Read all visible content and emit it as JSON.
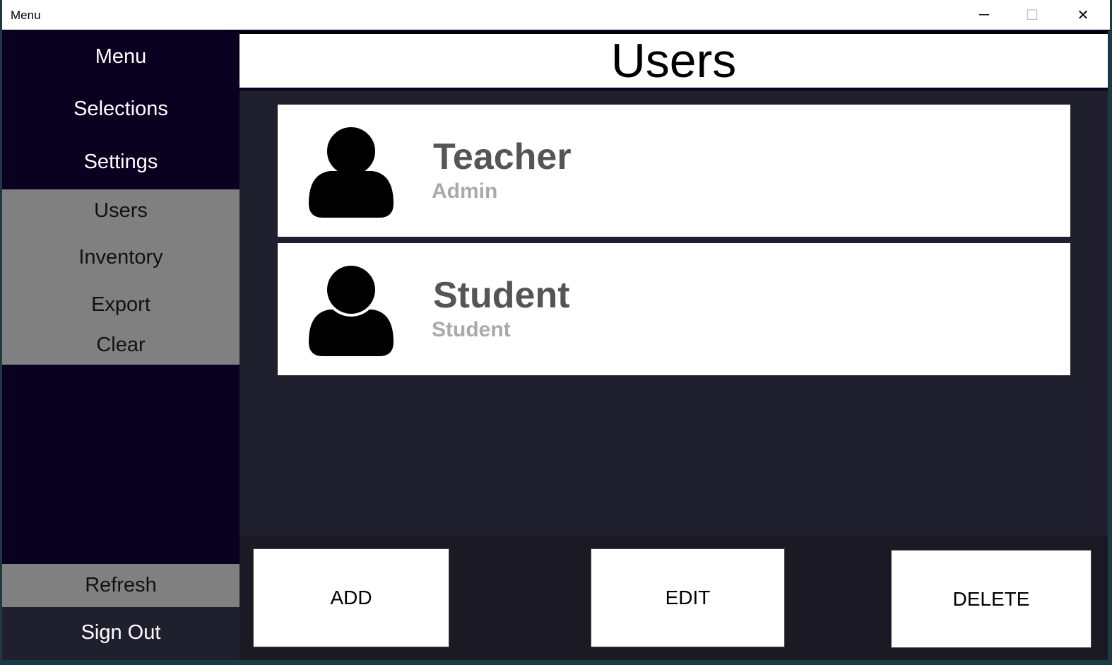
{
  "window": {
    "title": "Menu",
    "minimize": "─",
    "maximize": "☐",
    "close": "✕"
  },
  "sidebar": {
    "heading": "Menu",
    "items": [
      "Selections",
      "Settings"
    ],
    "sub_items": [
      "Users",
      "Inventory",
      "Export",
      "Clear"
    ],
    "refresh": "Refresh",
    "sign_out": "Sign Out"
  },
  "header": {
    "title": "Users"
  },
  "users": [
    {
      "name": "Teacher",
      "role": "Admin"
    },
    {
      "name": "Student",
      "role": "Student"
    }
  ],
  "actions": {
    "add": "ADD",
    "edit": "EDIT",
    "delete": "DELETE"
  },
  "colors": {
    "sidebar": "#0a0020",
    "content": "#201f2d",
    "highlight": "#808080"
  }
}
